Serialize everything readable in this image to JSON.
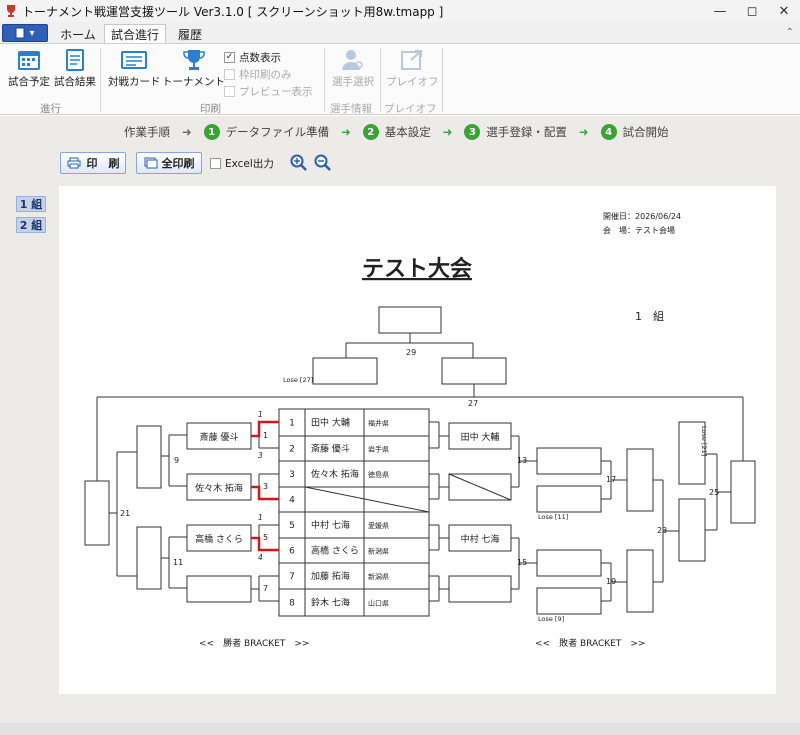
{
  "window": {
    "title": "トーナメント戦運営支援ツール  Ver3.1.0 [ スクリーンショット用8w.tmapp ]"
  },
  "tabs": [
    "ホーム",
    "試合進行",
    "履歴"
  ],
  "ribbon": {
    "progress": {
      "schedule": "試合予定",
      "results": "試合結果",
      "group": "進行"
    },
    "print": {
      "card": "対戦カード",
      "tournament": "トーナメント",
      "show_score": "点数表示",
      "frame_only": "枠印刷のみ",
      "preview": "プレビュー表示",
      "group": "印刷"
    },
    "player": {
      "select": "選手選択",
      "group": "選手情報"
    },
    "playoff": {
      "label": "プレイオフ",
      "group": "プレイオフ"
    }
  },
  "steps": {
    "label": "作業手順",
    "items": [
      {
        "num": "1",
        "label": "データファイル準備"
      },
      {
        "num": "2",
        "label": "基本設定"
      },
      {
        "num": "3",
        "label": "選手登録・配置"
      },
      {
        "num": "4",
        "label": "試合開始"
      }
    ]
  },
  "toolbar": {
    "print": "印　刷",
    "print_all": "全印刷",
    "excel": "Excel出力"
  },
  "groups": [
    "1 組",
    "2 組"
  ],
  "sheet": {
    "date": "開催日：2026/06/24",
    "venue": "会　場：テスト会場",
    "title": "テスト大会",
    "group": "1　組",
    "winners_label": "<<　勝者 BRACKET　>>",
    "losers_label": "<<　敗者 BRACKET　>>",
    "lose27": "Lose [27]",
    "lose21": "Lose [21]",
    "lose11": "Lose [11]",
    "lose9": "Lose [9]",
    "players": [
      {
        "no": "1",
        "name": "田中 大輔",
        "pref": "福井県"
      },
      {
        "no": "2",
        "name": "斎藤 優斗",
        "pref": "岩手県"
      },
      {
        "no": "3",
        "name": "佐々木 拓海",
        "pref": "徳島県"
      },
      {
        "no": "4",
        "name": "",
        "pref": ""
      },
      {
        "no": "5",
        "name": "中村 七海",
        "pref": "愛媛県"
      },
      {
        "no": "6",
        "name": "高橋 さくら",
        "pref": "新潟県"
      },
      {
        "no": "7",
        "name": "加藤 拓海",
        "pref": "新潟県"
      },
      {
        "no": "8",
        "name": "鈴木 七海",
        "pref": "山口県"
      }
    ],
    "w_r1": [
      "斎藤 優斗",
      "佐々木 拓海",
      "高橋 さくら",
      ""
    ],
    "l_r1": [
      "田中 大輔",
      "",
      "中村 七海",
      ""
    ],
    "match_nums": [
      "1",
      "3",
      "5",
      "7",
      "9",
      "11",
      "13",
      "15",
      "17",
      "19",
      "21",
      "23",
      "25",
      "27",
      "29"
    ],
    "scores": [
      "1",
      "3",
      "1",
      "4"
    ]
  }
}
